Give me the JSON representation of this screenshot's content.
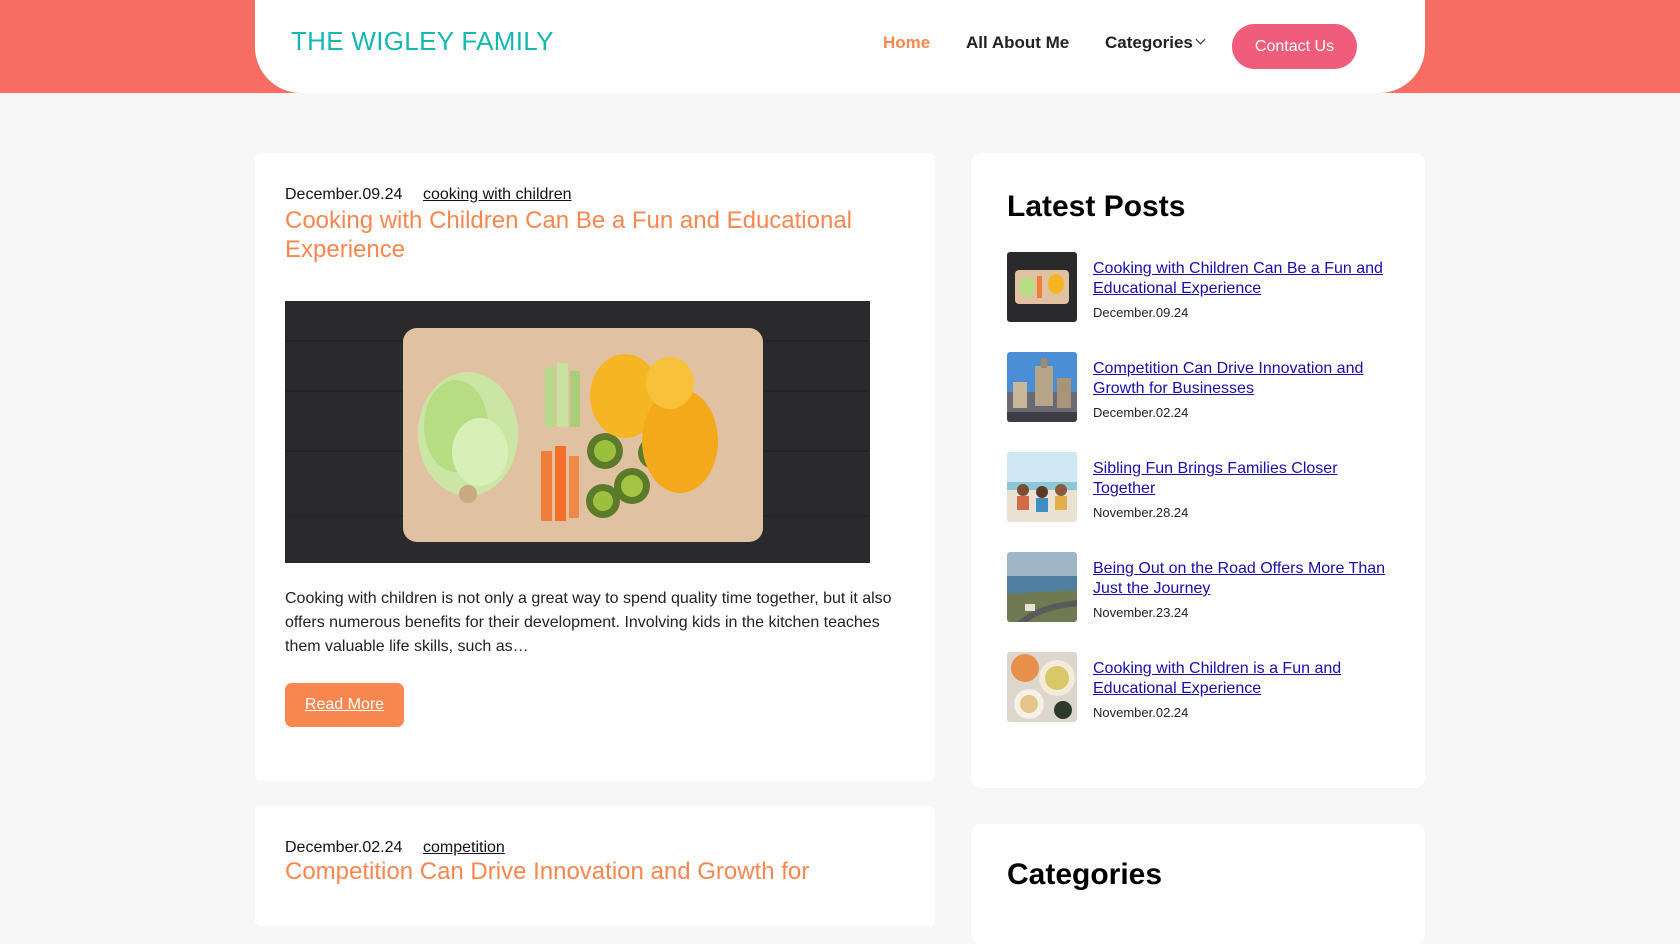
{
  "header": {
    "site_title": "THE WIGLEY FAMILY",
    "nav": {
      "home": "Home",
      "about": "All About Me",
      "categories": "Categories",
      "contact": "Contact Us"
    }
  },
  "posts": [
    {
      "date": "December.09.24",
      "category": "cooking with children",
      "title": "Cooking with Children Can Be a Fun and Educational Experience",
      "excerpt": "Cooking with children is not only a great way to spend quality time together, but it also offers numerous benefits for their development. Involving kids in the kitchen teaches them valuable life skills, such as…",
      "read_more": "Read More"
    },
    {
      "date": "December.02.24",
      "category": "competition",
      "title": "Competition Can Drive Innovation and Growth for"
    }
  ],
  "sidebar": {
    "latest_heading": "Latest Posts",
    "latest": [
      {
        "title": "Cooking with Children Can Be a Fun and Educational Experience",
        "date": "December.09.24"
      },
      {
        "title": "Competition Can Drive Innovation and Growth for Businesses",
        "date": "December.02.24"
      },
      {
        "title": "Sibling Fun Brings Families Closer Together",
        "date": "November.28.24"
      },
      {
        "title": "Being Out on the Road Offers More Than Just the Journey",
        "date": "November.23.24"
      },
      {
        "title": "Cooking with Children is a Fun and Educational Experience",
        "date": "November.02.24"
      }
    ],
    "categories_heading": "Categories"
  },
  "colors": {
    "header_band": "#f76d63",
    "site_title": "#14b8b0",
    "accent_orange": "#f7874f",
    "contact_pink": "#ef5c7c",
    "link_blue": "#1a0dab"
  }
}
